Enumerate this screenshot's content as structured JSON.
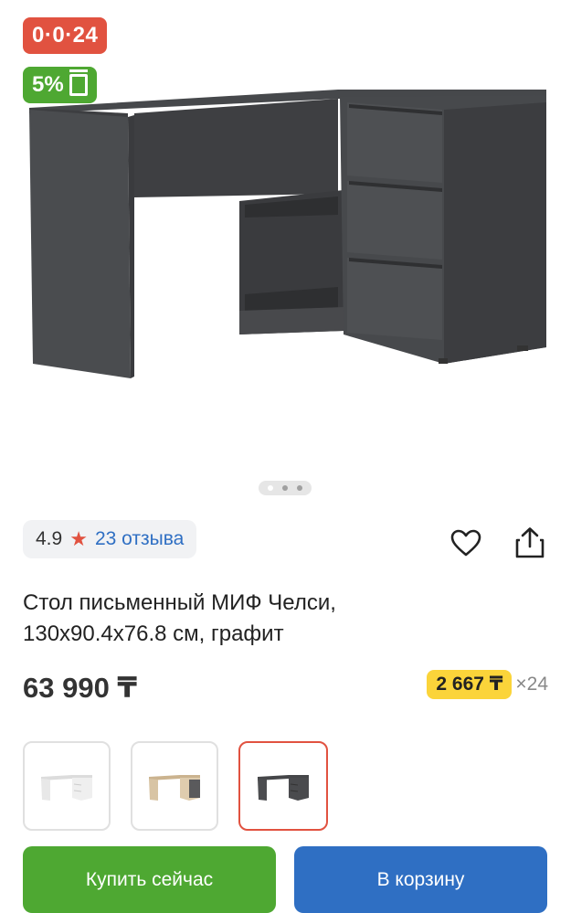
{
  "badges": {
    "installment": "0·0·24",
    "cashback": "5%"
  },
  "product": {
    "image": "desk-graphite-icon",
    "title_line1": "Стол письменный МИФ Челси,",
    "title_line2": "130x90.4x76.8 см, графит",
    "price": "63 990 ₸"
  },
  "gallery": {
    "pages": 3,
    "active_page": 1
  },
  "rating": {
    "value": "4.9",
    "star_icon": "star-icon",
    "reviews": "23 отзыва"
  },
  "actions": {
    "favorite_icon": "heart-icon",
    "share_icon": "share-icon"
  },
  "installment": {
    "amount": "2 667 ₸",
    "times": "×24"
  },
  "variants": [
    {
      "name": "white",
      "color": "#e7e7e7",
      "selected": false
    },
    {
      "name": "sonoma-oak",
      "color": "#d4bea0",
      "selected": false
    },
    {
      "name": "graphite",
      "color": "#4a4b4d",
      "selected": true
    }
  ],
  "buttons": {
    "buy_now": "Купить сейчас",
    "to_cart": "В корзину"
  },
  "colors": {
    "red": "#e15240",
    "green": "#4ea832",
    "blue": "#2f6fc3",
    "yellow": "#fbd43a"
  }
}
